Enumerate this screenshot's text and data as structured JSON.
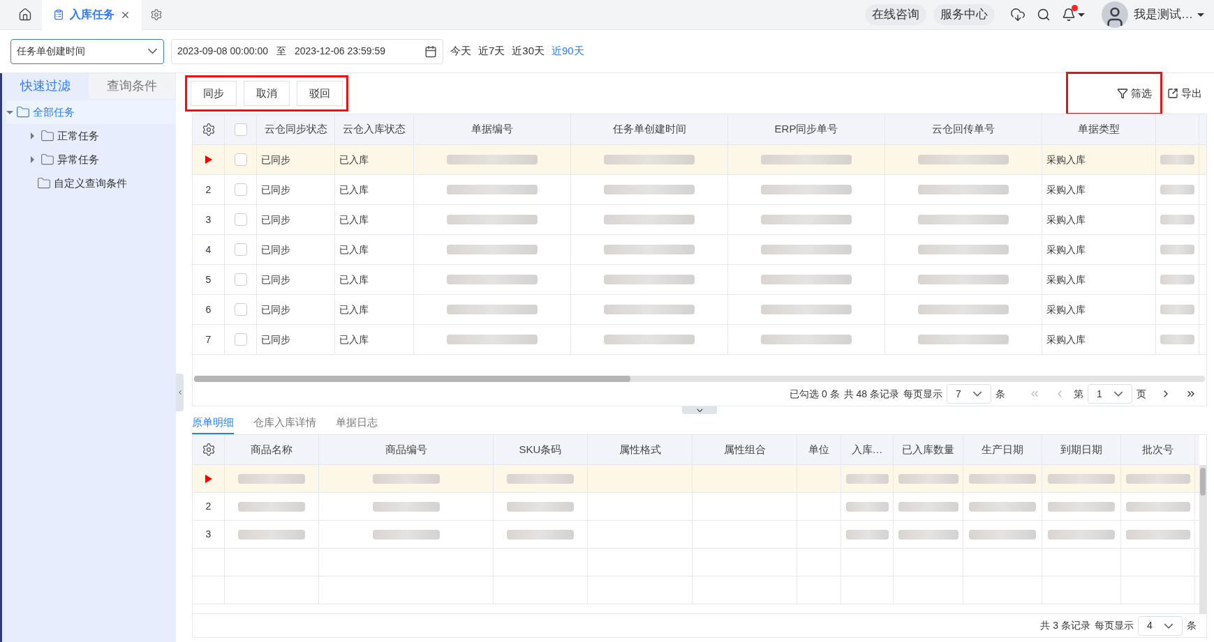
{
  "top_bar": {
    "tab": {
      "label": "入库任务",
      "selected": true
    },
    "actions": [
      {
        "label": "在线咨询"
      },
      {
        "label": "服务中心"
      }
    ],
    "notification_dot": true,
    "user": {
      "name": "我是测试…"
    }
  },
  "filter_bar": {
    "date_field": "任务单创建时间",
    "start": "2023-09-08 00:00:00",
    "separator": "至",
    "end": "2023-12-06 23:59:59",
    "quick_ranges": [
      {
        "label": "今天",
        "selected": false
      },
      {
        "label": "近7天",
        "selected": false
      },
      {
        "label": "近30天",
        "selected": false
      },
      {
        "label": "近90天",
        "selected": true
      }
    ]
  },
  "sidebar": {
    "tabs": [
      {
        "label": "快速过滤",
        "selected": true
      },
      {
        "label": "查询条件",
        "selected": false
      }
    ],
    "tree": [
      {
        "label": "全部任务",
        "selected": true,
        "expanded": true,
        "children": [
          {
            "label": "正常任务",
            "selected": false,
            "expanded": false
          },
          {
            "label": "异常任务",
            "selected": false,
            "expanded": false
          },
          {
            "label": "自定义查询条件",
            "selected": false
          }
        ]
      }
    ]
  },
  "toolbar": {
    "highlighted": true,
    "buttons": [
      {
        "label": "同步"
      },
      {
        "label": "取消"
      },
      {
        "label": "驳回"
      }
    ],
    "actions": [
      {
        "kind": "filter",
        "label": "筛选",
        "highlighted": true
      },
      {
        "kind": "export",
        "label": "导出",
        "highlighted": false
      }
    ]
  },
  "task_table": {
    "header_checked": false,
    "columns": [
      {
        "label": "云仓同步状态",
        "redacted": false
      },
      {
        "label": "云仓入库状态",
        "redacted": false
      },
      {
        "label": "单据编号",
        "redacted": true
      },
      {
        "label": "任务单创建时间",
        "redacted": true
      },
      {
        "label": "ERP同步单号",
        "redacted": true
      },
      {
        "label": "云仓回传单号",
        "redacted": true
      },
      {
        "label": "单据类型",
        "redacted": false
      },
      {
        "redacted": true
      }
    ],
    "rows": [
      {
        "selected": true,
        "checked": false,
        "values": [
          "已同步",
          "已入库",
          "采购入库"
        ]
      },
      {
        "number": "2",
        "selected": false,
        "checked": false,
        "values": [
          "已同步",
          "已入库",
          "采购入库"
        ]
      },
      {
        "number": "3",
        "selected": false,
        "checked": false,
        "values": [
          "已同步",
          "已入库",
          "采购入库"
        ]
      },
      {
        "number": "4",
        "selected": false,
        "checked": false,
        "values": [
          "已同步",
          "已入库",
          "采购入库"
        ]
      },
      {
        "number": "5",
        "selected": false,
        "checked": false,
        "values": [
          "已同步",
          "已入库",
          "采购入库"
        ]
      },
      {
        "number": "6",
        "selected": false,
        "checked": false,
        "values": [
          "已同步",
          "已入库",
          "采购入库"
        ]
      },
      {
        "number": "7",
        "selected": false,
        "checked": false,
        "values": [
          "已同步",
          "已入库",
          "采购入库"
        ]
      }
    ],
    "pagination": {
      "selected_info": "已勾选 0 条",
      "total": "共 48 条记录",
      "per_page_label": "每页显示",
      "per_page": "7",
      "unit": "条",
      "page_prefix": "第",
      "page": "1",
      "page_suffix": "页"
    }
  },
  "detail_tabs": [
    {
      "label": "原单明细",
      "selected": true
    },
    {
      "label": "仓库入库详情",
      "selected": false
    },
    {
      "label": "单据日志",
      "selected": false
    }
  ],
  "detail_table": {
    "columns": [
      {
        "label": "商品名称",
        "redacted": true
      },
      {
        "label": "商品编号",
        "redacted": true
      },
      {
        "label": "SKU条码",
        "redacted": true
      },
      {
        "label": "属性格式",
        "redacted": false
      },
      {
        "label": "属性组合",
        "redacted": false
      },
      {
        "label": "单位",
        "redacted": false
      },
      {
        "label": "入库…",
        "redacted": true
      },
      {
        "label": "已入库数量",
        "redacted": true
      },
      {
        "label": "生产日期",
        "redacted": true
      },
      {
        "label": "到期日期",
        "redacted": true
      },
      {
        "label": "批次号",
        "redacted": true
      }
    ],
    "rows": [
      {
        "selected": true
      },
      {
        "number": "2",
        "selected": false
      },
      {
        "number": "3",
        "selected": false
      }
    ],
    "pagination": {
      "total": "共 3 条记录",
      "per_page_label": "每页显示",
      "per_page": "4",
      "unit": "条"
    }
  }
}
